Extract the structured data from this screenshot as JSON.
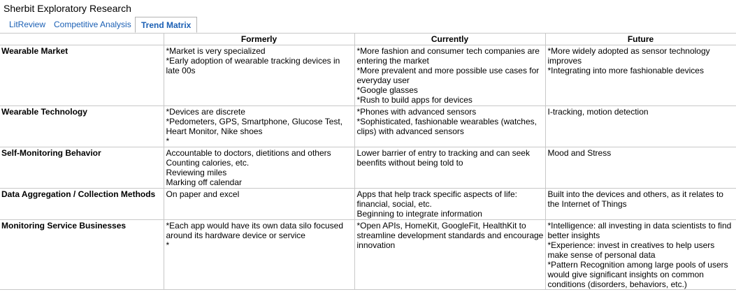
{
  "app": {
    "title": "Sherbit Exploratory Research"
  },
  "tabs": [
    {
      "label": "LitReview",
      "active": false
    },
    {
      "label": "Competitive Analysis",
      "active": false
    },
    {
      "label": "Trend Matrix",
      "active": true
    }
  ],
  "table": {
    "headers": [
      "",
      "Formerly",
      "Currently",
      "Future"
    ],
    "rows": [
      {
        "label": "Wearable Market",
        "formerly": "*Market is very specialized\n*Early adoption of wearable tracking devices in late 00s",
        "currently": "*More fashion and consumer tech companies are entering the market\n*More prevalent and more possible use cases for everyday user\n*Google glasses\n*Rush to build apps for devices",
        "future": "*More widely adopted as sensor technology improves\n*Integrating into more fashionable devices"
      },
      {
        "label": "Wearable Technology",
        "formerly": "*Devices are discrete\n*Pedometers, GPS, Smartphone, Glucose Test, Heart Monitor, Nike shoes\n*",
        "currently": "*Phones with advanced sensors\n*Sophisticated, fashionable wearables (watches, clips) with advanced sensors",
        "future": "I-tracking, motion detection"
      },
      {
        "label": "Self-Monitoring Behavior",
        "formerly": "Accountable to doctors, dietitions and others\nCounting calories, etc.\nReviewing miles\nMarking off calendar",
        "currently": "Lower barrier of entry to tracking and can seek beenfits without being told to",
        "future": "Mood and Stress"
      },
      {
        "label": "Data Aggregation / Collection Methods",
        "formerly": "On paper and excel",
        "currently": "Apps that help track specific aspects of life: financial, social, etc.\nBeginning to integrate information",
        "future": "Built into the devices and others, as it relates to the Internet of Things"
      },
      {
        "label": "Monitoring Service Businesses",
        "formerly": "*Each app would have its own data silo focused around its hardware device or service\n*",
        "currently": "*Open APIs, HomeKit, GoogleFit, HealthKit to streamline development standards and encourage innovation",
        "future": "*Intelligence: all investing in data scientists to find better insights\n*Experience: invest in creatives to help users make sense of personal data\n*Pattern Recognition among large pools of users would give significant insights on common conditions (disorders, behaviors, etc.)"
      }
    ]
  }
}
